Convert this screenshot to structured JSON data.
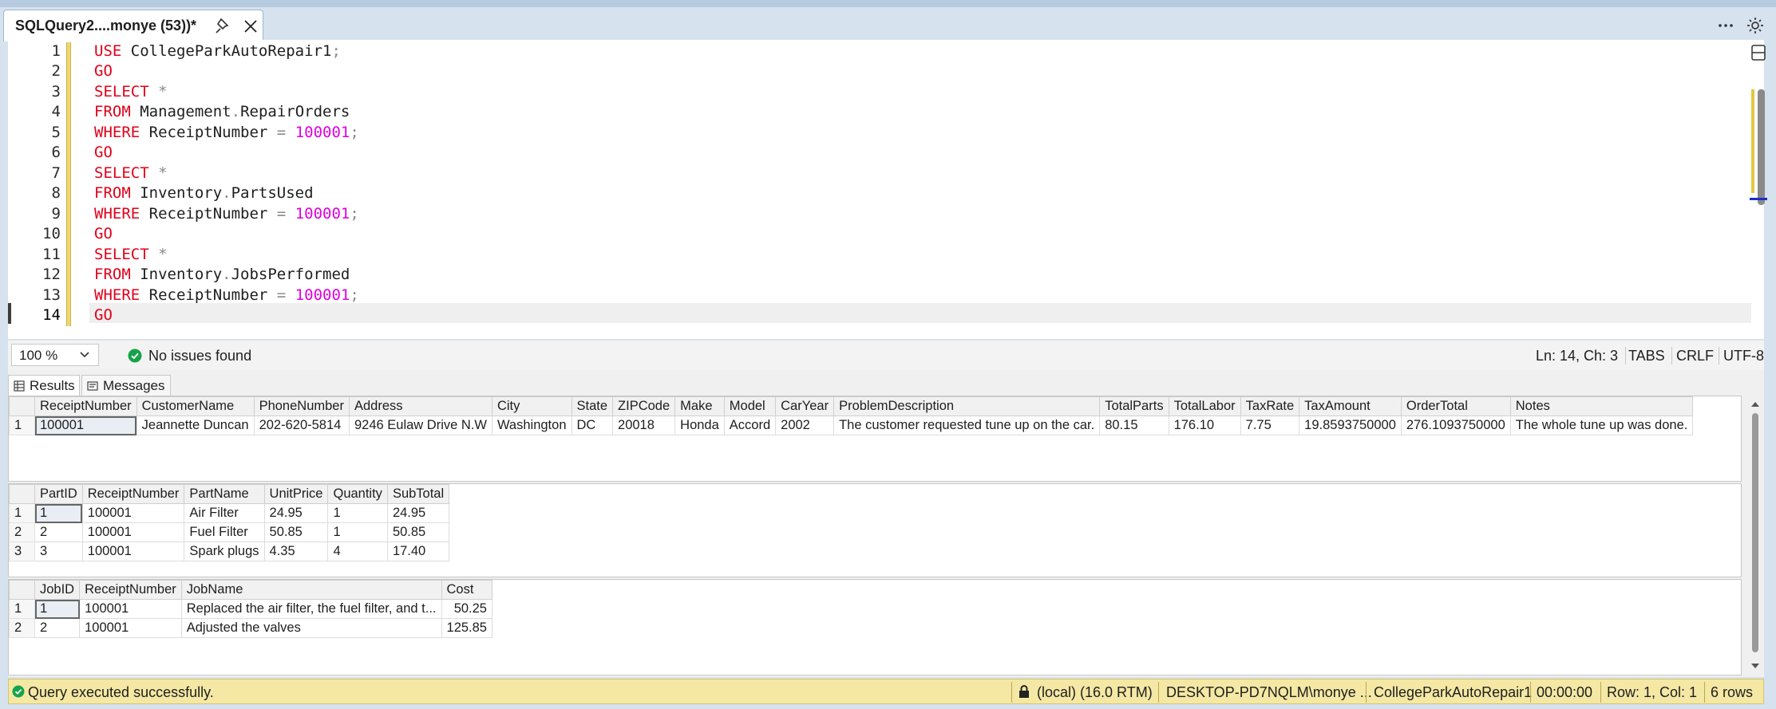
{
  "tab": {
    "title": "SQLQuery2....monye (53))*"
  },
  "editor": {
    "line_numbers": [
      "1",
      "2",
      "3",
      "4",
      "5",
      "6",
      "7",
      "8",
      "9",
      "10",
      "11",
      "12",
      "13",
      "14"
    ],
    "current_line": "14"
  },
  "editor_status": {
    "zoom": "100 %",
    "issues": "No issues found",
    "position": "Ln: 14, Ch: 3",
    "indent": "TABS",
    "line_endings": "CRLF",
    "encoding": "UTF-8"
  },
  "results_tabs": {
    "results": "Results",
    "messages": "Messages"
  },
  "grid1": {
    "columns": [
      "ReceiptNumber",
      "CustomerName",
      "PhoneNumber",
      "Address",
      "City",
      "State",
      "ZIPCode",
      "Make",
      "Model",
      "CarYear",
      "ProblemDescription",
      "TotalParts",
      "TotalLabor",
      "TaxRate",
      "TaxAmount",
      "OrderTotal",
      "Notes"
    ],
    "rows": [
      [
        "1",
        "100001",
        "Jeannette Duncan",
        "202-620-5814",
        "9246 Eulaw Drive N.W",
        "Washington",
        "DC",
        "20018",
        "Honda",
        "Accord",
        "2002",
        "The customer requested tune up on the car.",
        "80.15",
        "176.10",
        "7.75",
        "19.8593750000",
        "276.1093750000",
        "The whole tune up was done."
      ]
    ]
  },
  "grid2": {
    "columns": [
      "PartID",
      "ReceiptNumber",
      "PartName",
      "UnitPrice",
      "Quantity",
      "SubTotal"
    ],
    "rows": [
      [
        "1",
        "1",
        "100001",
        "Air Filter",
        "24.95",
        "1",
        "24.95"
      ],
      [
        "2",
        "2",
        "100001",
        "Fuel Filter",
        "50.85",
        "1",
        "50.85"
      ],
      [
        "3",
        "3",
        "100001",
        "Spark plugs",
        "4.35",
        "4",
        "17.40"
      ]
    ]
  },
  "grid3": {
    "columns": [
      "JobID",
      "ReceiptNumber",
      "JobName",
      "Cost"
    ],
    "rows": [
      [
        "1",
        "1",
        "100001",
        "Replaced the air filter, the fuel filter, and t...",
        "50.25"
      ],
      [
        "2",
        "2",
        "100001",
        "Adjusted the valves",
        "125.85"
      ]
    ]
  },
  "status": {
    "message": "Query executed successfully.",
    "server": "(local) (16.0 RTM)",
    "user": "DESKTOP-PD7NQLM\\monye ...",
    "database": "CollegeParkAutoRepair1",
    "elapsed": "00:00:00",
    "rowcol": "Row: 1, Col: 1",
    "rows": "6 rows"
  },
  "colors": {
    "keyword": "#e0001a",
    "number": "#e000e0",
    "status_bar": "#f4e8a4"
  }
}
